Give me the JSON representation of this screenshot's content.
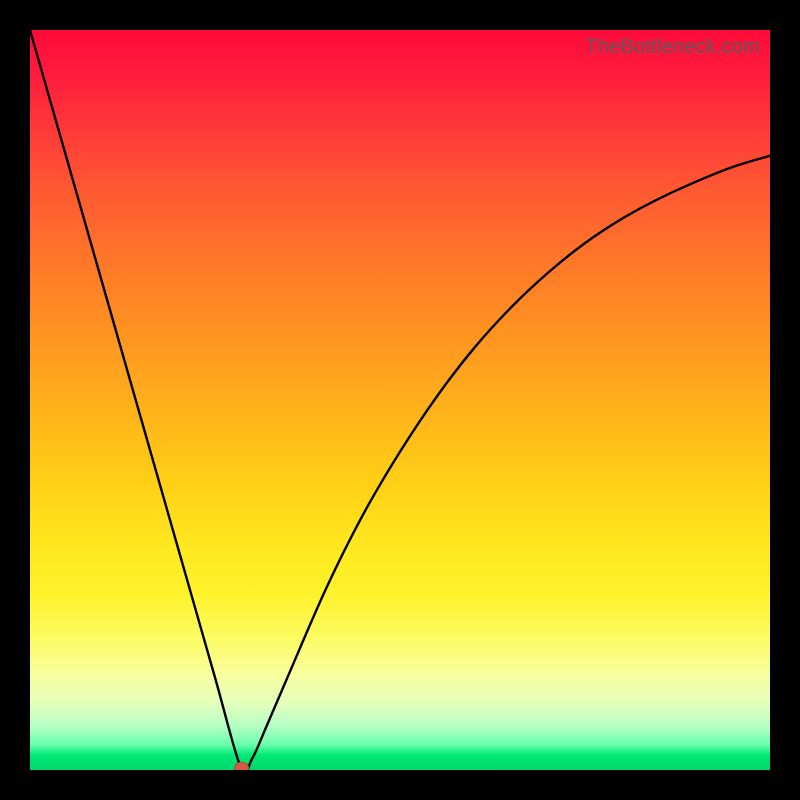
{
  "watermark": "TheBottleneck.com",
  "colors": {
    "frame": "#000000",
    "curve_stroke": "#000000",
    "marker_fill": "#d25a49",
    "marker_stroke": "#b34637"
  },
  "chart_data": {
    "type": "line",
    "title": "",
    "xlabel": "",
    "ylabel": "",
    "xlim": [
      0,
      100
    ],
    "ylim": [
      0,
      100
    ],
    "grid": false,
    "legend": false,
    "series": [
      {
        "name": "bottleneck-curve",
        "x": [
          0,
          5,
          10,
          15,
          20,
          25,
          28.5,
          30,
          32,
          35,
          40,
          45,
          50,
          55,
          60,
          65,
          70,
          75,
          80,
          85,
          90,
          95,
          100
        ],
        "y": [
          100,
          82.5,
          65,
          47.5,
          30,
          12.5,
          0.3,
          1.5,
          6,
          13,
          24.5,
          34.5,
          43,
          50.5,
          57,
          62.5,
          67.2,
          71.2,
          74.5,
          77.2,
          79.5,
          81.5,
          83
        ]
      }
    ],
    "annotations": [
      {
        "name": "minimum-marker",
        "x": 28.6,
        "y": 0.3
      }
    ],
    "background_gradient": {
      "type": "vertical",
      "stops": [
        {
          "pos": 0.0,
          "color": "#ff0a3a"
        },
        {
          "pos": 0.32,
          "color": "#ff7928"
        },
        {
          "pos": 0.62,
          "color": "#ffd216"
        },
        {
          "pos": 0.82,
          "color": "#fdfb60"
        },
        {
          "pos": 0.94,
          "color": "#b6ffc4"
        },
        {
          "pos": 1.0,
          "color": "#00d86b"
        }
      ]
    }
  }
}
